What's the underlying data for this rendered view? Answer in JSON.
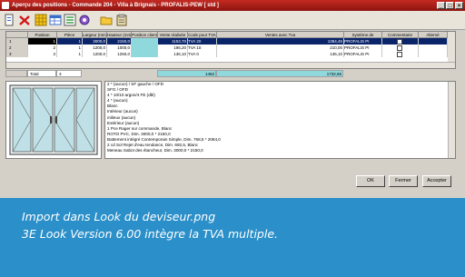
{
  "window": {
    "title": "Aperçu des positions - Commande 204 - Villa à Brignais - PROFALIS-PEW [ std ]",
    "controls": [
      "_",
      "□",
      "×"
    ]
  },
  "toolbar": {
    "icons": [
      "new-document-icon",
      "delete-icon",
      "grid-view-icon",
      "table-view-icon",
      "list-view-icon",
      "options-icon",
      "folder-icon",
      "clipboard-icon"
    ]
  },
  "grid": {
    "headers": [
      "Position",
      "Pièce",
      "Largeur (mm)",
      "Hauteur (mm)",
      "Position client",
      "Vente réalisée",
      "Code pour TVA",
      "Ventes avec Tva",
      "Système de",
      "Commentaire",
      "Alterné"
    ],
    "rows": [
      {
        "num": "1",
        "cells": [
          "1",
          "1",
          "3000,0",
          "2150,0",
          "",
          "1153,70",
          "TVA 20",
          "1384,45",
          "PROFALIS PI",
          "",
          ""
        ],
        "selected": true
      },
      {
        "num": "2",
        "cells": [
          "2",
          "1",
          "1200,0",
          "1000,0",
          "",
          "196,20",
          "TVA 10",
          "210,00",
          "PROFALIS PI",
          "",
          ""
        ],
        "selected": false
      },
      {
        "num": "3",
        "cells": [
          "3",
          "1",
          "1200,0",
          "1250,0",
          "",
          "136,10",
          "TVA 0",
          "136,10",
          "PROFALIS PI",
          "",
          ""
        ],
        "selected": false
      }
    ]
  },
  "totals": {
    "label": "Total",
    "count": "3",
    "sale": "1462",
    "with_tax": "1732,55"
  },
  "description": {
    "lines": [
      "2 * (aucun) / SF gauche / OFD",
      "SFG / OFD",
      "4 * 10/10 argon/4 FE (dbl)",
      "4 * (aucun)",
      "Blanc",
      "Intérieur (aucun)",
      "milieux (aucun)",
      "Extérieur (aucun)",
      "1 Pce Rager sur commande, Blanc",
      "ROTO PVC, Dim. 3000,0 * 2150,0",
      "Battement intégré Contemporain Simple, Dim. 768,5 * 2084,0",
      "2 cd Sol Rejet d'eau tendance, Dim. 692,5, Blanc",
      "Meneau Sabot des étancheur, Dim. 3000,0 * 2150,0"
    ]
  },
  "buttons": {
    "ok": "OK",
    "fermer": "Fermer",
    "accepter": "Accepter"
  },
  "caption": {
    "line1": "Import dans Look du deviseur.png",
    "line2": "3E Look Version 6.00 intègre la TVA multiple."
  },
  "colors": {
    "background": "#2b8fc9",
    "titlebar": "#b01e18",
    "selection": "#0a246a",
    "teal_cell": "#8fd9dc"
  }
}
